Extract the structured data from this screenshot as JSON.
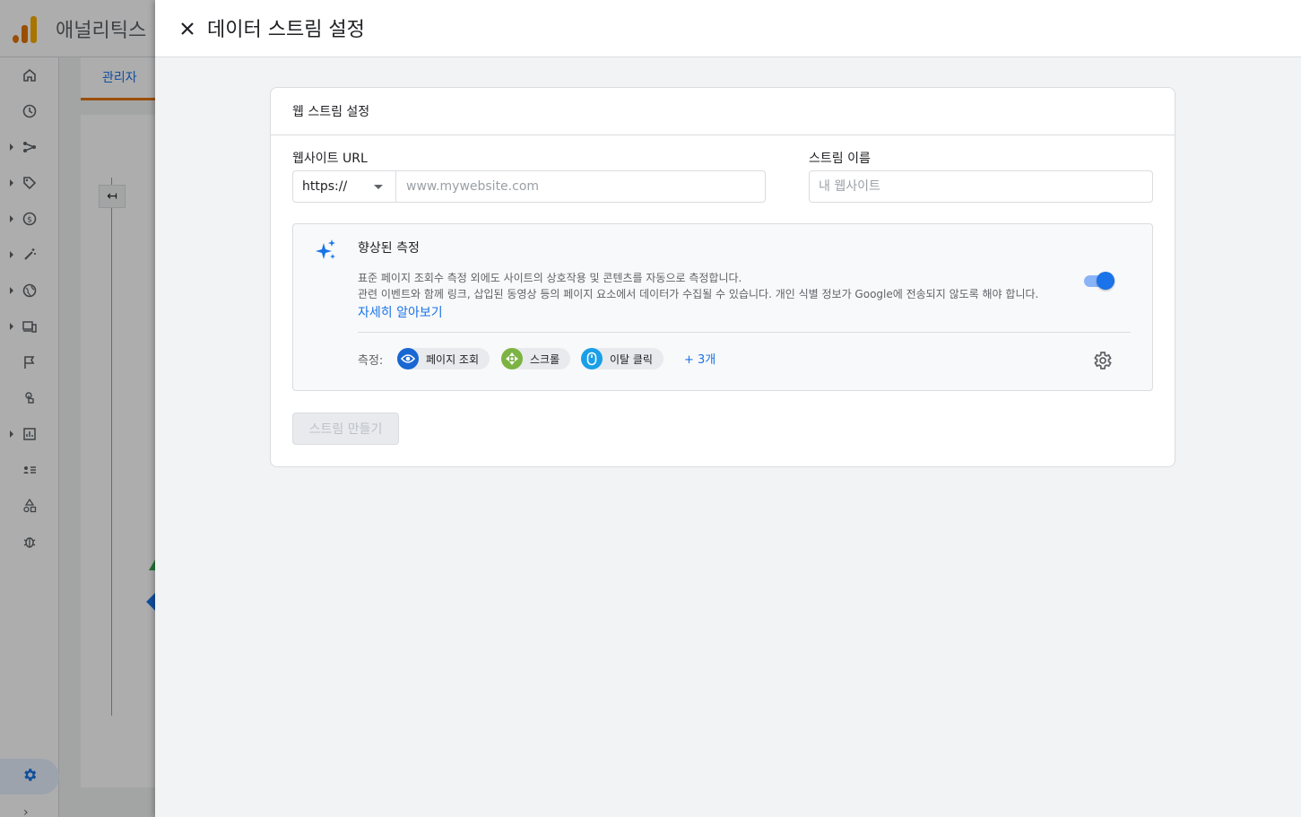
{
  "app": {
    "title": "애널리틱스"
  },
  "background": {
    "tab_admin": "관리자"
  },
  "panel": {
    "title": "데이터 스트림 설정"
  },
  "card": {
    "title": "웹 스트림 설정",
    "url_label": "웹사이트 URL",
    "protocol": "https://",
    "url_placeholder": "www.mywebsite.com",
    "name_label": "스트림 이름",
    "name_placeholder": "내 웹사이트",
    "create_button": "스트림 만들기"
  },
  "enhanced": {
    "title": "향상된 측정",
    "desc_line1": "표준 페이지 조회수 측정 외에도 사이트의 상호작용 및 콘텐츠를 자동으로 측정합니다.",
    "desc_line2": "관련 이벤트와 함께 링크, 삽입된 동영상 등의 페이지 요소에서 데이터가 수집될 수 있습니다. 개인 식별 정보가 Google에 전송되지 않도록 해야 합니다.",
    "learn_more": "자세히 알아보기",
    "toggle_on": true,
    "measure_label": "측정:",
    "chips": [
      {
        "label": "페이지 조회",
        "icon": "eye-icon",
        "color": "#1967d2"
      },
      {
        "label": "스크롤",
        "icon": "scroll-target-icon",
        "color": "#7cb342"
      },
      {
        "label": "이탈 클릭",
        "icon": "mouse-icon",
        "color": "#1a9fe8"
      }
    ],
    "more": "+ 3개"
  },
  "colors": {
    "accent": "#1a73e8",
    "brand_orange": "#e37400",
    "brand_yellow": "#f9ab00"
  }
}
